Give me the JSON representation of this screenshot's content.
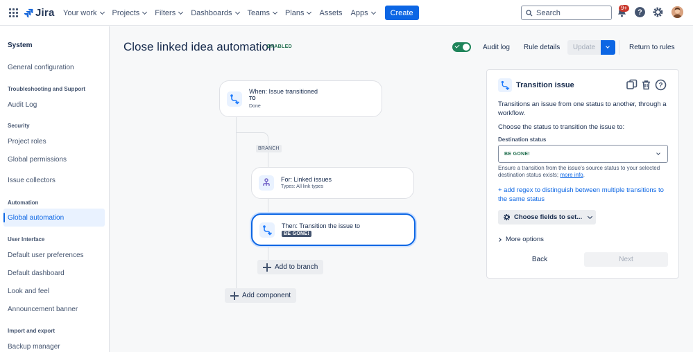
{
  "topnav": {
    "brand": "Jira",
    "items": [
      {
        "label": "Your work",
        "has_menu": true
      },
      {
        "label": "Projects",
        "has_menu": true
      },
      {
        "label": "Filters",
        "has_menu": true
      },
      {
        "label": "Dashboards",
        "has_menu": true
      },
      {
        "label": "Teams",
        "has_menu": true
      },
      {
        "label": "Plans",
        "has_menu": true
      },
      {
        "label": "Assets",
        "has_menu": false
      },
      {
        "label": "Apps",
        "has_menu": true
      }
    ],
    "create_label": "Create",
    "search_placeholder": "Search",
    "notifications_badge": "9+"
  },
  "sidebar": {
    "title": "System",
    "general": "General configuration",
    "sections": [
      {
        "heading": "Troubleshooting and Support",
        "items": [
          "Audit Log"
        ]
      },
      {
        "heading": "Security",
        "items": [
          "Project roles",
          "Global permissions",
          "Issue collectors"
        ]
      },
      {
        "heading": "Automation",
        "items": [
          "Global automation"
        ]
      },
      {
        "heading": "User Interface",
        "items": [
          "Default user preferences",
          "Default dashboard",
          "Look and feel",
          "Announcement banner"
        ]
      },
      {
        "heading": "Import and export",
        "items": [
          "Backup manager"
        ]
      }
    ],
    "active_item": "Global automation"
  },
  "header": {
    "title": "Close linked idea automation",
    "status": "ENABLED",
    "audit_log": "Audit log",
    "rule_details": "Rule details",
    "update": "Update",
    "return": "Return to rules"
  },
  "flow": {
    "trigger": {
      "title": "When: Issue transitioned",
      "to_label": "TO",
      "to_value": "Done"
    },
    "branch_label": "BRANCH",
    "branch": {
      "title": "For: Linked issues",
      "sub": "Types: All link types"
    },
    "action": {
      "title": "Then: Transition the issue to",
      "status": "BE GONE!"
    },
    "add_branch": "Add to branch",
    "add_component": "Add component"
  },
  "panel": {
    "title": "Transition issue",
    "description": "Transitions an issue from one status to another, through a workflow.",
    "choose_text": "Choose the status to transition the issue to:",
    "dest_label": "Destination status",
    "dest_value": "BE GONE!",
    "help_text": "Ensure a transition from the issue's source status to your selected destination status exists;",
    "help_link": "more info",
    "help_end": ".",
    "regex_link": "+ add regex to distinguish between multiple transitions to the same status",
    "choose_fields": "Choose fields to set...",
    "more_options": "More options",
    "back": "Back",
    "next": "Next"
  },
  "colors": {
    "brand": "#0c66e4",
    "enabled": "#216e4e",
    "toggle_on": "#1f845a"
  }
}
